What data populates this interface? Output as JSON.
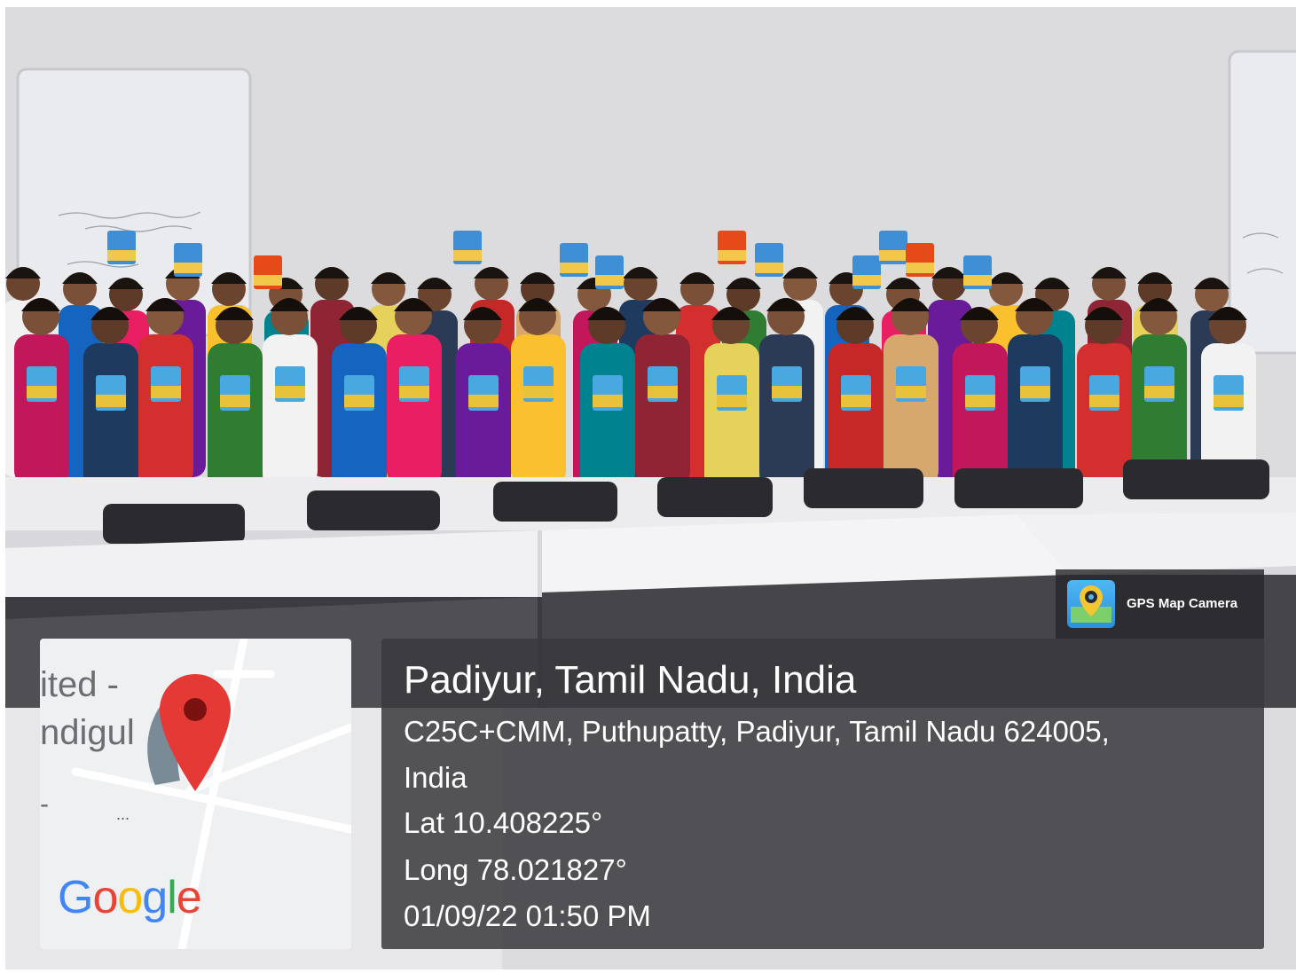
{
  "badge": {
    "label": "GPS Map Camera",
    "icon": "gps-map-camera-app-icon"
  },
  "map": {
    "label_line_1": "ited -",
    "label_line_2": "ndigul",
    "label_line_3": "-",
    "dots": "...",
    "pin_icon": "map-pin-icon",
    "pin_color": "#e53935",
    "logo_letters": [
      "G",
      "o",
      "o",
      "g",
      "l",
      "e"
    ],
    "logo_colors": [
      "#4285F4",
      "#EA4335",
      "#FBBC05",
      "#4285F4",
      "#34A853",
      "#EA4335"
    ]
  },
  "info": {
    "title": "Padiyur, Tamil Nadu, India",
    "address_line_1": "C25C+CMM, Puthupatty, Padiyur, Tamil Nadu 624005,",
    "address_line_2": "India",
    "latitude": "Lat 10.408225°",
    "longitude": "Long 78.021827°",
    "timestamp": "01/09/22 01:50 PM"
  }
}
